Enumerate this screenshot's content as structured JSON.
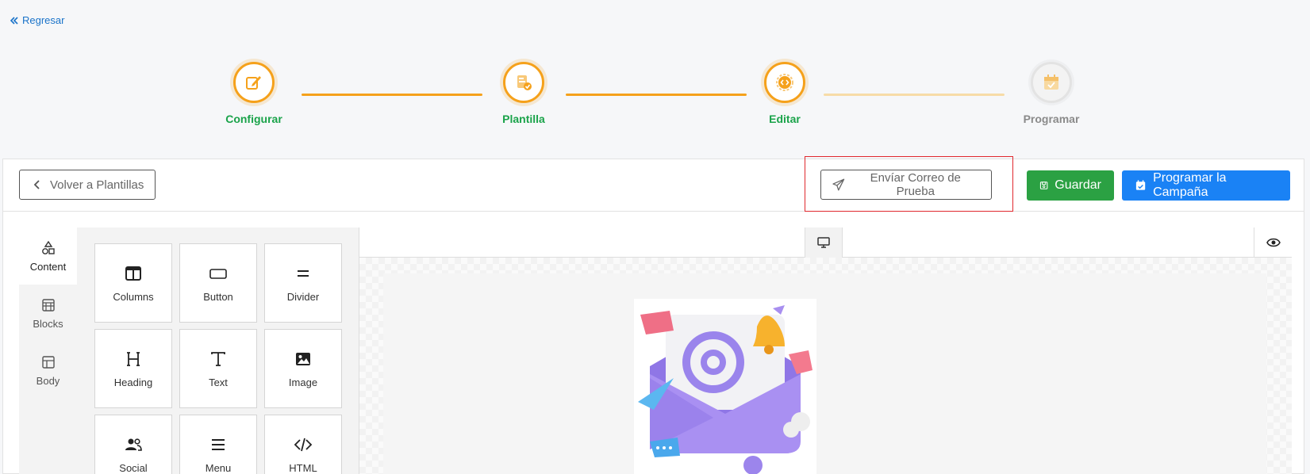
{
  "back_link": {
    "label": "Regresar"
  },
  "stepper": {
    "steps": [
      {
        "label": "Configurar",
        "state": "done",
        "icon": "edit-icon"
      },
      {
        "label": "Plantilla",
        "state": "done",
        "icon": "template-check-icon"
      },
      {
        "label": "Editar",
        "state": "current",
        "icon": "code-gear-icon"
      },
      {
        "label": "Programar",
        "state": "pending",
        "icon": "calendar-check-icon"
      }
    ],
    "colors": {
      "active": "#f5a11b",
      "done_label": "#1aa34a",
      "pending_label": "#8a8a8a"
    }
  },
  "toolbar": {
    "back_to_templates": "Volver a Plantillas",
    "send_test": "Envíar Correo de Prueba",
    "save": "Guardar",
    "schedule": "Programar la Campaña",
    "colors": {
      "save": "#2ba143",
      "schedule": "#1a82f5",
      "highlight": "#e0282e"
    }
  },
  "sidebar_tabs": [
    {
      "label": "Content",
      "icon": "shapes-icon",
      "active": true
    },
    {
      "label": "Blocks",
      "icon": "blocks-icon",
      "active": false
    },
    {
      "label": "Body",
      "icon": "body-layout-icon",
      "active": false
    }
  ],
  "tools": [
    {
      "label": "Columns",
      "icon": "columns-icon"
    },
    {
      "label": "Button",
      "icon": "button-icon"
    },
    {
      "label": "Divider",
      "icon": "divider-icon"
    },
    {
      "label": "Heading",
      "icon": "heading-icon"
    },
    {
      "label": "Text",
      "icon": "text-icon"
    },
    {
      "label": "Image",
      "icon": "image-icon"
    },
    {
      "label": "Social",
      "icon": "social-icon"
    },
    {
      "label": "Menu",
      "icon": "menu-icon"
    },
    {
      "label": "HTML",
      "icon": "html-icon"
    }
  ],
  "canvas": {
    "device": "desktop-icon",
    "preview": "eye-icon",
    "image": "email-envelope-illustration"
  }
}
